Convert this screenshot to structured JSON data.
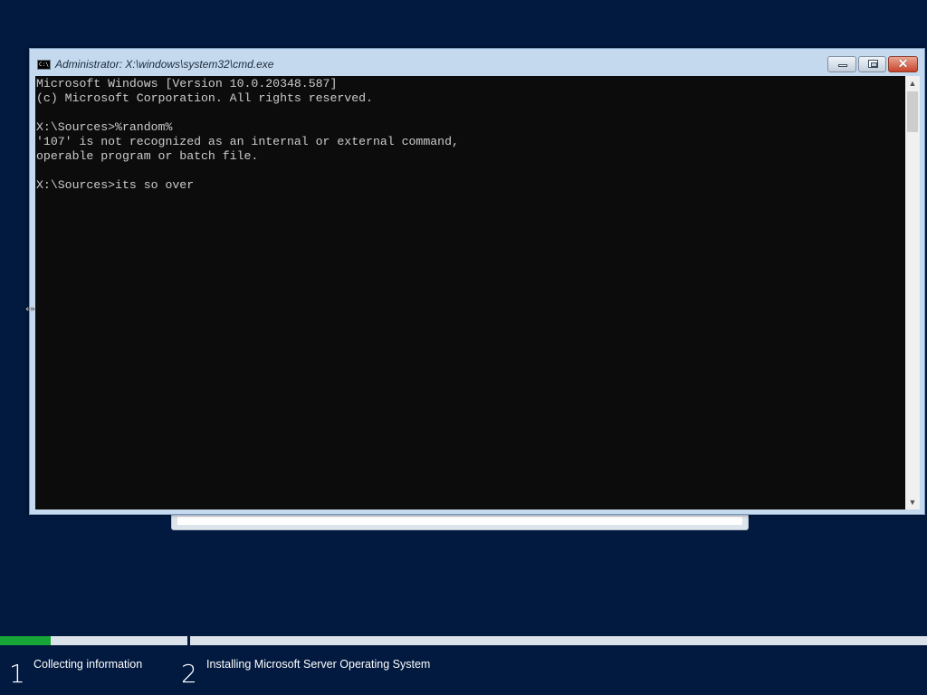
{
  "window": {
    "title": "Administrator: X:\\windows\\system32\\cmd.exe",
    "icon": "cmd-icon",
    "icon_text": "C:\\",
    "buttons": {
      "minimize": "minimize-icon",
      "maximize": "maximize-icon",
      "close": "close-icon",
      "close_glyph": "✕"
    }
  },
  "console": {
    "background": "#0c0c0c",
    "text_color": "#cccccc",
    "lines": [
      "Microsoft Windows [Version 10.0.20348.587]",
      "(c) Microsoft Corporation. All rights reserved.",
      "",
      "X:\\Sources>%random%",
      "'107' is not recognized as an internal or external command,",
      "operable program or batch file.",
      "",
      "X:\\Sources>its so over"
    ]
  },
  "scrollbar": {
    "up_arrow": "▲",
    "down_arrow": "▼"
  },
  "cursor": {
    "icon": "horizontal-resize-cursor-icon",
    "glyph": "⇔"
  },
  "setup": {
    "progress_fraction": 0.055,
    "progress_color": "#18a537",
    "steps": [
      {
        "number": "1",
        "label": "Collecting information"
      },
      {
        "number": "2",
        "label": "Installing Microsoft Server Operating System"
      }
    ]
  },
  "colors": {
    "desktop": "#021a40",
    "window_frame": "#c5d9ee",
    "close_button": "#c8442a"
  }
}
